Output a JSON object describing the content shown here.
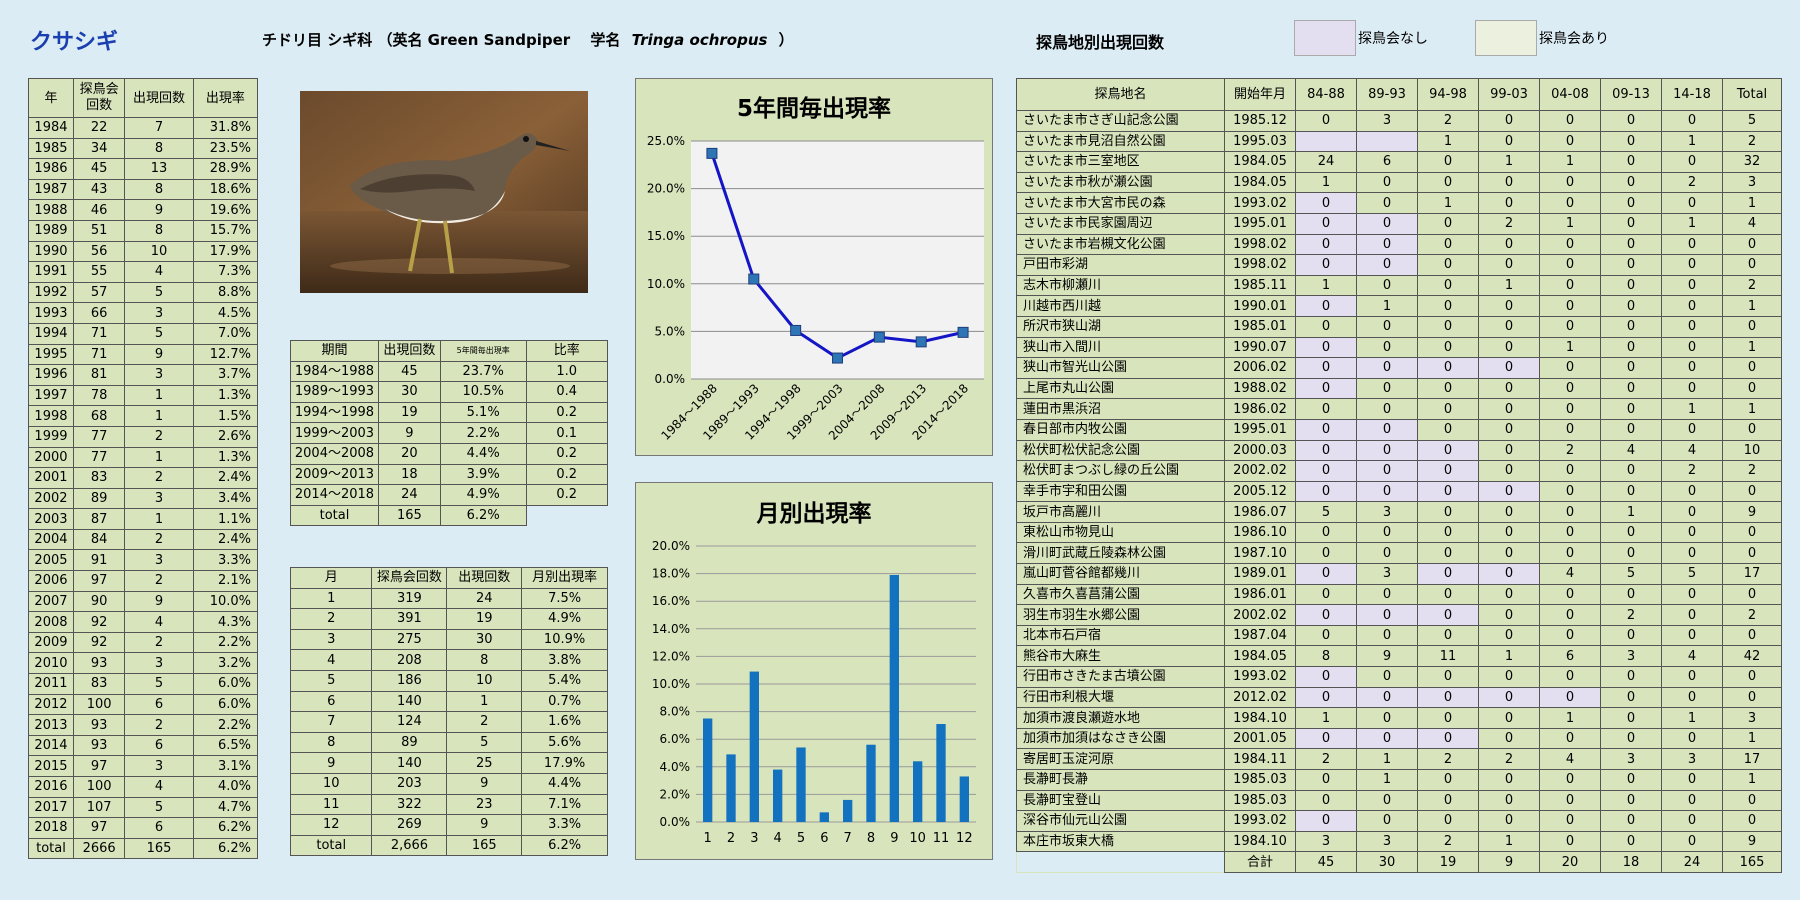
{
  "header": {
    "title": "クサシギ",
    "species_info": "チドリ目 シギ科 （英名 Green Sandpiper　 学名",
    "scientific_name": "Tringa ochropus",
    "species_close": "）",
    "site_section_title": "探鳥地別出現回数",
    "legend_none": "探鳥会なし",
    "legend_some": "探鳥会あり"
  },
  "year_table": {
    "headers": [
      "年",
      "探鳥会回数",
      "出現回数",
      "出現率"
    ],
    "rows": [
      [
        "1984",
        "22",
        "7",
        "31.8%"
      ],
      [
        "1985",
        "34",
        "8",
        "23.5%"
      ],
      [
        "1986",
        "45",
        "13",
        "28.9%"
      ],
      [
        "1987",
        "43",
        "8",
        "18.6%"
      ],
      [
        "1988",
        "46",
        "9",
        "19.6%"
      ],
      [
        "1989",
        "51",
        "8",
        "15.7%"
      ],
      [
        "1990",
        "56",
        "10",
        "17.9%"
      ],
      [
        "1991",
        "55",
        "4",
        "7.3%"
      ],
      [
        "1992",
        "57",
        "5",
        "8.8%"
      ],
      [
        "1993",
        "66",
        "3",
        "4.5%"
      ],
      [
        "1994",
        "71",
        "5",
        "7.0%"
      ],
      [
        "1995",
        "71",
        "9",
        "12.7%"
      ],
      [
        "1996",
        "81",
        "3",
        "3.7%"
      ],
      [
        "1997",
        "78",
        "1",
        "1.3%"
      ],
      [
        "1998",
        "68",
        "1",
        "1.5%"
      ],
      [
        "1999",
        "77",
        "2",
        "2.6%"
      ],
      [
        "2000",
        "77",
        "1",
        "1.3%"
      ],
      [
        "2001",
        "83",
        "2",
        "2.4%"
      ],
      [
        "2002",
        "89",
        "3",
        "3.4%"
      ],
      [
        "2003",
        "87",
        "1",
        "1.1%"
      ],
      [
        "2004",
        "84",
        "2",
        "2.4%"
      ],
      [
        "2005",
        "91",
        "3",
        "3.3%"
      ],
      [
        "2006",
        "97",
        "2",
        "2.1%"
      ],
      [
        "2007",
        "90",
        "9",
        "10.0%"
      ],
      [
        "2008",
        "92",
        "4",
        "4.3%"
      ],
      [
        "2009",
        "92",
        "2",
        "2.2%"
      ],
      [
        "2010",
        "93",
        "3",
        "3.2%"
      ],
      [
        "2011",
        "83",
        "5",
        "6.0%"
      ],
      [
        "2012",
        "100",
        "6",
        "6.0%"
      ],
      [
        "2013",
        "93",
        "2",
        "2.2%"
      ],
      [
        "2014",
        "93",
        "6",
        "6.5%"
      ],
      [
        "2015",
        "97",
        "3",
        "3.1%"
      ],
      [
        "2016",
        "100",
        "4",
        "4.0%"
      ],
      [
        "2017",
        "107",
        "5",
        "4.7%"
      ],
      [
        "2018",
        "97",
        "6",
        "6.2%"
      ]
    ],
    "total": [
      "total",
      "2666",
      "165",
      "6.2%"
    ]
  },
  "period_table": {
    "headers": [
      "期間",
      "出現回数",
      "5年間毎出現率",
      "比率"
    ],
    "rows": [
      [
        "1984～1988",
        "45",
        "23.7%",
        "1.0"
      ],
      [
        "1989～1993",
        "30",
        "10.5%",
        "0.4"
      ],
      [
        "1994～1998",
        "19",
        "5.1%",
        "0.2"
      ],
      [
        "1999～2003",
        "9",
        "2.2%",
        "0.1"
      ],
      [
        "2004～2008",
        "20",
        "4.4%",
        "0.2"
      ],
      [
        "2009～2013",
        "18",
        "3.9%",
        "0.2"
      ],
      [
        "2014～2018",
        "24",
        "4.9%",
        "0.2"
      ]
    ],
    "total": [
      "total",
      "165",
      "6.2%"
    ]
  },
  "month_table": {
    "headers": [
      "月",
      "探鳥会回数",
      "出現回数",
      "月別出現率"
    ],
    "rows": [
      [
        "1",
        "319",
        "24",
        "7.5%"
      ],
      [
        "2",
        "391",
        "19",
        "4.9%"
      ],
      [
        "3",
        "275",
        "30",
        "10.9%"
      ],
      [
        "4",
        "208",
        "8",
        "3.8%"
      ],
      [
        "5",
        "186",
        "10",
        "5.4%"
      ],
      [
        "6",
        "140",
        "1",
        "0.7%"
      ],
      [
        "7",
        "124",
        "2",
        "1.6%"
      ],
      [
        "8",
        "89",
        "5",
        "5.6%"
      ],
      [
        "9",
        "140",
        "25",
        "17.9%"
      ],
      [
        "10",
        "203",
        "9",
        "4.4%"
      ],
      [
        "11",
        "322",
        "23",
        "7.1%"
      ],
      [
        "12",
        "269",
        "9",
        "3.3%"
      ]
    ],
    "total": [
      "total",
      "2,666",
      "165",
      "6.2%"
    ]
  },
  "site_table": {
    "headers": [
      "探鳥地名",
      "開始年月",
      "84-88",
      "89-93",
      "94-98",
      "99-03",
      "04-08",
      "09-13",
      "14-18",
      "Total"
    ],
    "rows": [
      {
        "name": "さいたま市さぎ山記念公園",
        "start": "1985.12",
        "v": [
          "0",
          "3",
          "2",
          "0",
          "0",
          "0",
          "0",
          "5"
        ],
        "p": []
      },
      {
        "name": "さいたま市見沼自然公園",
        "start": "1995.03",
        "v": [
          "",
          "",
          "1",
          "0",
          "0",
          "0",
          "1",
          "2"
        ],
        "p": [
          0,
          1
        ]
      },
      {
        "name": "さいたま市三室地区",
        "start": "1984.05",
        "v": [
          "24",
          "6",
          "0",
          "1",
          "1",
          "0",
          "0",
          "32"
        ],
        "p": []
      },
      {
        "name": "さいたま市秋が瀬公園",
        "start": "1984.05",
        "v": [
          "1",
          "0",
          "0",
          "0",
          "0",
          "0",
          "2",
          "3"
        ],
        "p": []
      },
      {
        "name": "さいたま市大宮市民の森",
        "start": "1993.02",
        "v": [
          "0",
          "0",
          "1",
          "0",
          "0",
          "0",
          "0",
          "1"
        ],
        "p": [
          0
        ]
      },
      {
        "name": "さいたま市民家園周辺",
        "start": "1995.01",
        "v": [
          "0",
          "0",
          "0",
          "2",
          "1",
          "0",
          "1",
          "4"
        ],
        "p": [
          0,
          1
        ]
      },
      {
        "name": "さいたま市岩槻文化公園",
        "start": "1998.02",
        "v": [
          "0",
          "0",
          "0",
          "0",
          "0",
          "0",
          "0",
          "0"
        ],
        "p": [
          0,
          1
        ]
      },
      {
        "name": "戸田市彩湖",
        "start": "1998.02",
        "v": [
          "0",
          "0",
          "0",
          "0",
          "0",
          "0",
          "0",
          "0"
        ],
        "p": [
          0,
          1
        ]
      },
      {
        "name": "志木市柳瀬川",
        "start": "1985.11",
        "v": [
          "1",
          "0",
          "0",
          "1",
          "0",
          "0",
          "0",
          "2"
        ],
        "p": []
      },
      {
        "name": "川越市西川越",
        "start": "1990.01",
        "v": [
          "0",
          "1",
          "0",
          "0",
          "0",
          "0",
          "0",
          "1"
        ],
        "p": [
          0
        ]
      },
      {
        "name": "所沢市狭山湖",
        "start": "1985.01",
        "v": [
          "0",
          "0",
          "0",
          "0",
          "0",
          "0",
          "0",
          "0"
        ],
        "p": []
      },
      {
        "name": "狭山市入間川",
        "start": "1990.07",
        "v": [
          "0",
          "0",
          "0",
          "0",
          "1",
          "0",
          "0",
          "1"
        ],
        "p": [
          0
        ]
      },
      {
        "name": "狭山市智光山公園",
        "start": "2006.02",
        "v": [
          "0",
          "0",
          "0",
          "0",
          "0",
          "0",
          "0",
          "0"
        ],
        "p": [
          0,
          1,
          2,
          3
        ]
      },
      {
        "name": "上尾市丸山公園",
        "start": "1988.02",
        "v": [
          "0",
          "0",
          "0",
          "0",
          "0",
          "0",
          "0",
          "0"
        ],
        "p": [
          0
        ]
      },
      {
        "name": "蓮田市黒浜沼",
        "start": "1986.02",
        "v": [
          "0",
          "0",
          "0",
          "0",
          "0",
          "0",
          "1",
          "1"
        ],
        "p": []
      },
      {
        "name": "春日部市内牧公園",
        "start": "1995.01",
        "v": [
          "0",
          "0",
          "0",
          "0",
          "0",
          "0",
          "0",
          "0"
        ],
        "p": [
          0,
          1
        ]
      },
      {
        "name": "松伏町松伏記念公園",
        "start": "2000.03",
        "v": [
          "0",
          "0",
          "0",
          "0",
          "2",
          "4",
          "4",
          "10"
        ],
        "p": [
          0,
          1,
          2
        ]
      },
      {
        "name": "松伏町まつぶし緑の丘公園",
        "start": "2002.02",
        "v": [
          "0",
          "0",
          "0",
          "0",
          "0",
          "0",
          "2",
          "2"
        ],
        "p": [
          0,
          1,
          2
        ]
      },
      {
        "name": "幸手市宇和田公園",
        "start": "2005.12",
        "v": [
          "0",
          "0",
          "0",
          "0",
          "0",
          "0",
          "0",
          "0"
        ],
        "p": [
          0,
          1,
          2,
          3
        ]
      },
      {
        "name": "坂戸市高麗川",
        "start": "1986.07",
        "v": [
          "5",
          "3",
          "0",
          "0",
          "0",
          "1",
          "0",
          "9"
        ],
        "p": []
      },
      {
        "name": "東松山市物見山",
        "start": "1986.10",
        "v": [
          "0",
          "0",
          "0",
          "0",
          "0",
          "0",
          "0",
          "0"
        ],
        "p": []
      },
      {
        "name": "滑川町武蔵丘陵森林公園",
        "start": "1987.10",
        "v": [
          "0",
          "0",
          "0",
          "0",
          "0",
          "0",
          "0",
          "0"
        ],
        "p": []
      },
      {
        "name": "嵐山町菅谷館都幾川",
        "start": "1989.01",
        "v": [
          "0",
          "3",
          "0",
          "0",
          "4",
          "5",
          "5",
          "17"
        ],
        "p": [
          0,
          2,
          3
        ]
      },
      {
        "name": "久喜市久喜菖蒲公園",
        "start": "1986.01",
        "v": [
          "0",
          "0",
          "0",
          "0",
          "0",
          "0",
          "0",
          "0"
        ],
        "p": []
      },
      {
        "name": "羽生市羽生水郷公園",
        "start": "2002.02",
        "v": [
          "0",
          "0",
          "0",
          "0",
          "0",
          "2",
          "0",
          "2"
        ],
        "p": [
          0,
          1,
          2
        ]
      },
      {
        "name": "北本市石戸宿",
        "start": "1987.04",
        "v": [
          "0",
          "0",
          "0",
          "0",
          "0",
          "0",
          "0",
          "0"
        ],
        "p": []
      },
      {
        "name": "熊谷市大麻生",
        "start": "1984.05",
        "v": [
          "8",
          "9",
          "11",
          "1",
          "6",
          "3",
          "4",
          "42"
        ],
        "p": []
      },
      {
        "name": "行田市さきたま古墳公園",
        "start": "1993.02",
        "v": [
          "0",
          "0",
          "0",
          "0",
          "0",
          "0",
          "0",
          "0"
        ],
        "p": [
          0
        ]
      },
      {
        "name": "行田市利根大堰",
        "start": "2012.02",
        "v": [
          "0",
          "0",
          "0",
          "0",
          "0",
          "0",
          "0",
          "0"
        ],
        "p": [
          0,
          1,
          2,
          3,
          4
        ]
      },
      {
        "name": "加須市渡良瀬遊水地",
        "start": "1984.10",
        "v": [
          "1",
          "0",
          "0",
          "0",
          "1",
          "0",
          "1",
          "3"
        ],
        "p": []
      },
      {
        "name": "加須市加須はなさき公園",
        "start": "2001.05",
        "v": [
          "0",
          "0",
          "0",
          "0",
          "0",
          "0",
          "0",
          "1"
        ],
        "p": [
          0,
          1,
          2
        ]
      },
      {
        "name": "寄居町玉淀河原",
        "start": "1984.11",
        "v": [
          "2",
          "1",
          "2",
          "2",
          "4",
          "3",
          "3",
          "17"
        ],
        "p": []
      },
      {
        "name": "長瀞町長瀞",
        "start": "1985.03",
        "v": [
          "0",
          "1",
          "0",
          "0",
          "0",
          "0",
          "0",
          "1"
        ],
        "p": []
      },
      {
        "name": "長瀞町宝登山",
        "start": "1985.03",
        "v": [
          "0",
          "0",
          "0",
          "0",
          "0",
          "0",
          "0",
          "0"
        ],
        "p": []
      },
      {
        "name": "深谷市仙元山公園",
        "start": "1993.02",
        "v": [
          "0",
          "0",
          "0",
          "0",
          "0",
          "0",
          "0",
          "0"
        ],
        "p": [
          0
        ]
      },
      {
        "name": "本庄市坂東大橋",
        "start": "1984.10",
        "v": [
          "3",
          "3",
          "2",
          "1",
          "0",
          "0",
          "0",
          "9"
        ],
        "p": []
      }
    ],
    "total_label": "合計",
    "totals": [
      "45",
      "30",
      "19",
      "9",
      "20",
      "18",
      "24",
      "165"
    ]
  },
  "colors": {
    "line": "#1515c8",
    "bar": "#1372c0",
    "panel": "#d8e4bc",
    "plot_bg": "#f2f2f2",
    "no_meeting": "#e4dff0",
    "meeting": "#ebf1de"
  },
  "chart_data": [
    {
      "type": "line",
      "title": "5年間毎出現率",
      "categories": [
        "1984～1988",
        "1989～1993",
        "1994～1998",
        "1999～2003",
        "2004～2008",
        "2009～2013",
        "2014～2018"
      ],
      "values": [
        23.7,
        10.5,
        5.1,
        2.2,
        4.4,
        3.9,
        4.9
      ],
      "ylim": [
        0,
        25
      ],
      "yticks": [
        "0.0%",
        "5.0%",
        "10.0%",
        "15.0%",
        "20.0%",
        "25.0%"
      ],
      "grid": true,
      "legend": "none"
    },
    {
      "type": "bar",
      "title": "月別出現率",
      "categories": [
        "1",
        "2",
        "3",
        "4",
        "5",
        "6",
        "7",
        "8",
        "9",
        "10",
        "11",
        "12"
      ],
      "values": [
        7.5,
        4.9,
        10.9,
        3.8,
        5.4,
        0.7,
        1.6,
        5.6,
        17.9,
        4.4,
        7.1,
        3.3
      ],
      "ylim": [
        0,
        20
      ],
      "yticks": [
        "0.0%",
        "2.0%",
        "4.0%",
        "6.0%",
        "8.0%",
        "10.0%",
        "12.0%",
        "14.0%",
        "16.0%",
        "18.0%",
        "20.0%"
      ],
      "grid": true,
      "legend": "none"
    }
  ]
}
